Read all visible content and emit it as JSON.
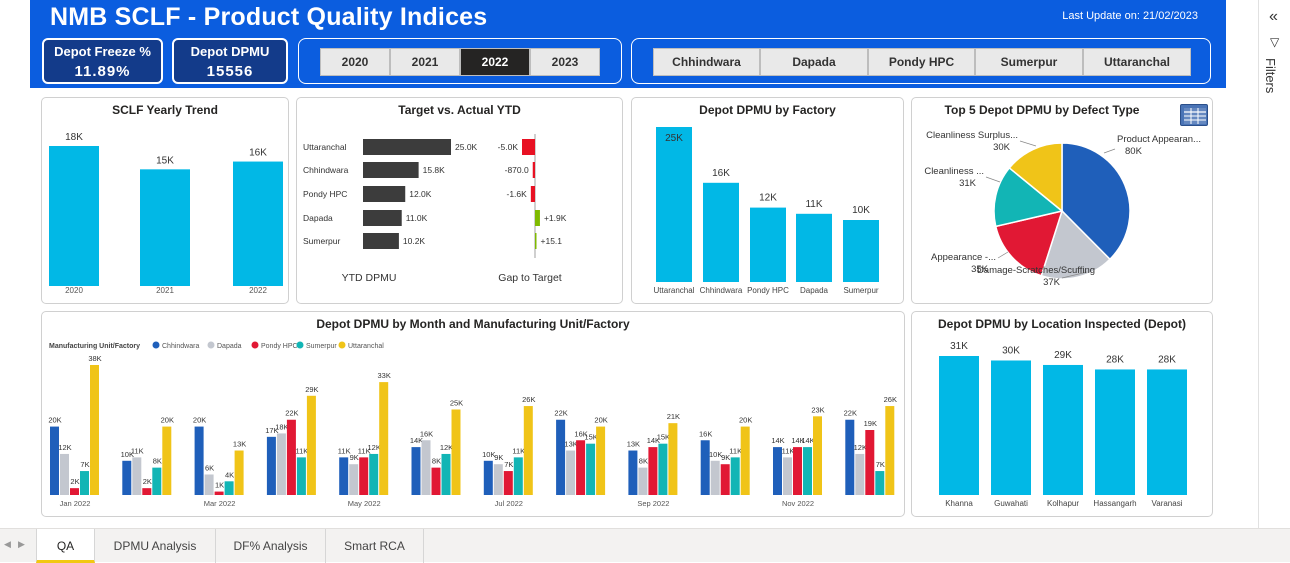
{
  "header": {
    "title": "NMB SCLF - Product Quality Indices",
    "last_update": "Last Update on: 21/02/2023"
  },
  "kpis": {
    "freeze_label": "Depot Freeze %",
    "freeze_value": "11.89%",
    "dpmu_label": "Depot DPMU",
    "dpmu_value": "15556"
  },
  "year_slicer": {
    "options": [
      "2020",
      "2021",
      "2022",
      "2023"
    ],
    "selected": "2022"
  },
  "factory_slicer": {
    "options": [
      "Chhindwara",
      "Dapada",
      "Pondy HPC",
      "Sumerpur",
      "Uttaranchal"
    ]
  },
  "colors": {
    "header_blue": "#0b5ddf",
    "kpi_navy": "#133b8a",
    "bar_cyan": "#01b8e6",
    "waterfall_dark": "#3c3c3c",
    "negative_red": "#e81123",
    "positive_green": "#7fba00",
    "tab_underline": "#f2c811"
  },
  "yearly_trend": {
    "title": "SCLF Yearly Trend",
    "chart_data": {
      "type": "bar",
      "categories": [
        "2020",
        "2021",
        "2022"
      ],
      "values": [
        18,
        15,
        16
      ],
      "labels": [
        "18K",
        "15K",
        "16K"
      ]
    }
  },
  "target_actual": {
    "title": "Target vs. Actual YTD",
    "ytd_label": "YTD DPMU",
    "gap_label": "Gap to Target",
    "chart_data": {
      "type": "bar",
      "categories": [
        "Uttaranchal",
        "Chhindwara",
        "Pondy HPC",
        "Dapada",
        "Sumerpur"
      ],
      "ytd_values": [
        25.0,
        15.8,
        12.0,
        11.0,
        10.2
      ],
      "ytd_labels": [
        "25.0K",
        "15.8K",
        "12.0K",
        "11.0K",
        "10.2K"
      ],
      "gap_values": [
        -5.0,
        -0.87,
        -1.6,
        1.9,
        0.0151
      ],
      "gap_labels": [
        "-5.0K",
        "-870.0",
        "-1.6K",
        "+1.9K",
        "+15.1"
      ]
    }
  },
  "dpmu_factory": {
    "title": "Depot DPMU by Factory",
    "chart_data": {
      "type": "bar",
      "categories": [
        "Uttaranchal",
        "Chhindwara",
        "Pondy HPC",
        "Dapada",
        "Sumerpur"
      ],
      "values": [
        25,
        16,
        12,
        11,
        10
      ],
      "labels": [
        "25K",
        "16K",
        "12K",
        "11K",
        "10K"
      ]
    }
  },
  "defect_type": {
    "title": "Top 5 Depot DPMU by Defect Type",
    "chart_data": {
      "type": "pie",
      "slices": [
        {
          "name": "Product Appearan...",
          "value": 80,
          "label": "80K",
          "color": "#1f5fba"
        },
        {
          "name": "Damage-Scratches/Scuffing",
          "value": 37,
          "label": "37K",
          "color": "#c3c7cf"
        },
        {
          "name": "Appearance -...",
          "value": 35,
          "label": "35K",
          "color": "#e11834"
        },
        {
          "name": "Cleanliness ...",
          "value": 31,
          "label": "31K",
          "color": "#12b5b5"
        },
        {
          "name": "Cleanliness Surplus...",
          "value": 30,
          "label": "30K",
          "color": "#f0c418"
        }
      ]
    }
  },
  "monthly": {
    "title": "Depot DPMU by Month and Manufacturing Unit/Factory",
    "legend_title": "Manufacturing Unit/Factory",
    "chart_data": {
      "type": "bar",
      "series": [
        {
          "name": "Chhindwara",
          "color": "#1f5fba",
          "values": [
            20,
            10,
            20,
            17,
            11,
            14,
            10,
            22,
            13,
            16,
            14,
            22
          ],
          "labels": [
            "20K",
            "10K",
            "20K",
            "17K",
            "11K",
            "14K",
            "10K",
            "22K",
            "13K",
            "16K",
            "14K",
            "22K"
          ]
        },
        {
          "name": "Dapada",
          "color": "#c3c7cf",
          "values": [
            12,
            11,
            6,
            18,
            9,
            16,
            9,
            13,
            8,
            10,
            11,
            12
          ],
          "labels": [
            "12K",
            "11K",
            "6K",
            "18K",
            "9K",
            "16K",
            "9K",
            "13K",
            "8K",
            "10K",
            "11K",
            "12K"
          ]
        },
        {
          "name": "Pondy HPC",
          "color": "#e11834",
          "values": [
            2,
            2,
            1,
            22,
            11,
            8,
            7,
            16,
            14,
            9,
            14,
            19
          ],
          "labels": [
            "2K",
            "2K",
            "1K",
            "22K",
            "11K",
            "8K",
            "7K",
            "16K",
            "14K",
            "9K",
            "14K",
            "19K"
          ]
        },
        {
          "name": "Sumerpur",
          "color": "#12b5b5",
          "values": [
            7,
            8,
            4,
            11,
            12,
            12,
            11,
            15,
            15,
            11,
            14,
            7
          ],
          "labels": [
            "7K",
            "8K",
            "4K",
            "11K",
            "12K",
            "12K",
            "11K",
            "15K",
            "15K",
            "11K",
            "14K",
            "7K"
          ]
        },
        {
          "name": "Uttaranchal",
          "color": "#f0c418",
          "values": [
            38,
            20,
            13,
            29,
            33,
            25,
            26,
            20,
            21,
            20,
            23,
            26
          ],
          "labels": [
            "38K",
            "20K",
            "13K",
            "29K",
            "33K",
            "25K",
            "26K",
            "20K",
            "21K",
            "20K",
            "23K",
            "26K"
          ]
        }
      ],
      "x_tick_labels": [
        "Jan 2022",
        "",
        "Mar 2022",
        "",
        "May 2022",
        "",
        "Jul 2022",
        "",
        "Sep 2022",
        "",
        "Nov 2022",
        ""
      ]
    }
  },
  "location": {
    "title": "Depot DPMU by Location Inspected (Depot)",
    "chart_data": {
      "type": "bar",
      "categories": [
        "Khanna",
        "Guwahati",
        "Kolhapur",
        "Hassangarh",
        "Varanasi"
      ],
      "values": [
        31,
        30,
        29,
        28,
        28
      ],
      "labels": [
        "31K",
        "30K",
        "29K",
        "28K",
        "28K"
      ]
    }
  },
  "filters_label": "Filters",
  "tabs": [
    "QA",
    "DPMU Analysis",
    "DF% Analysis",
    "Smart RCA"
  ]
}
